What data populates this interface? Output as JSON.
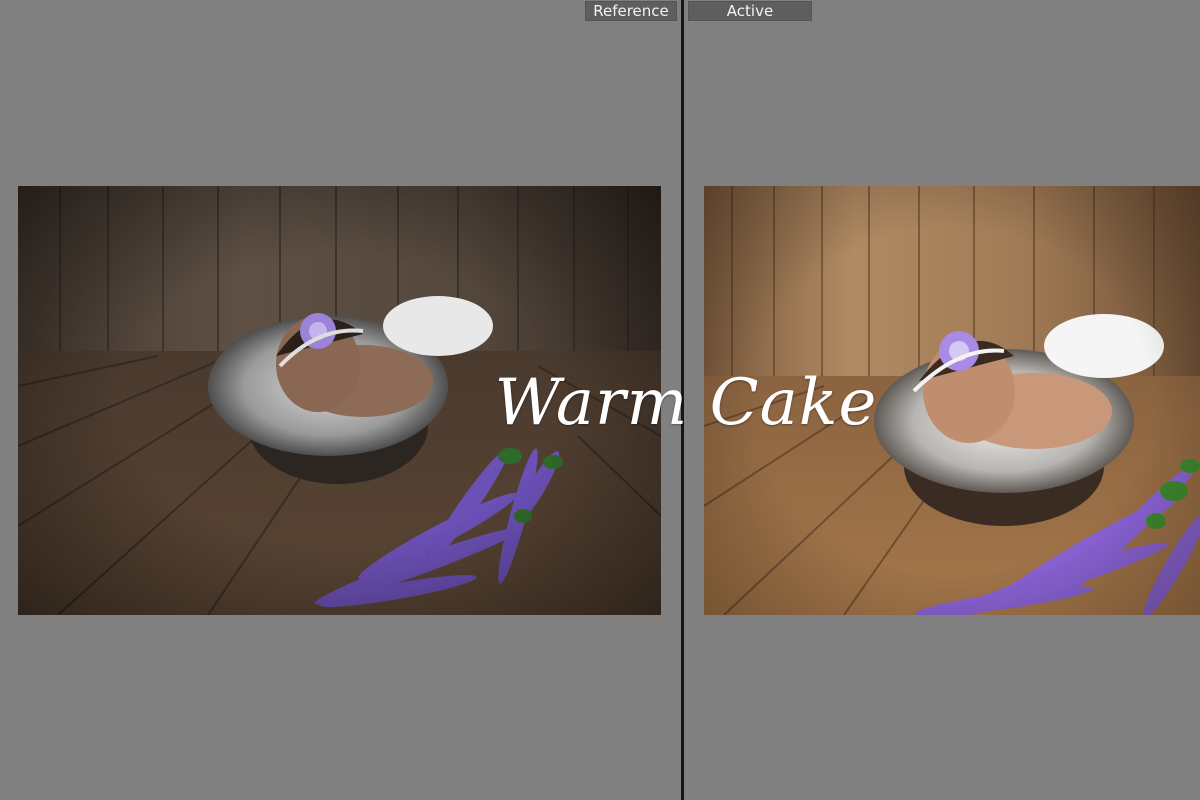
{
  "compare_view": {
    "reference_label": "Reference",
    "active_label": "Active"
  },
  "overlay": {
    "preset_title": "Warm Cake"
  },
  "colors": {
    "background": "#808080",
    "divider": "#151515",
    "label_background": "#5e5e5e",
    "label_text": "#f2f2f2",
    "reference_tone": "#5a4a3c",
    "active_tone": "#a07850",
    "lavender": "#7a5cc8"
  }
}
